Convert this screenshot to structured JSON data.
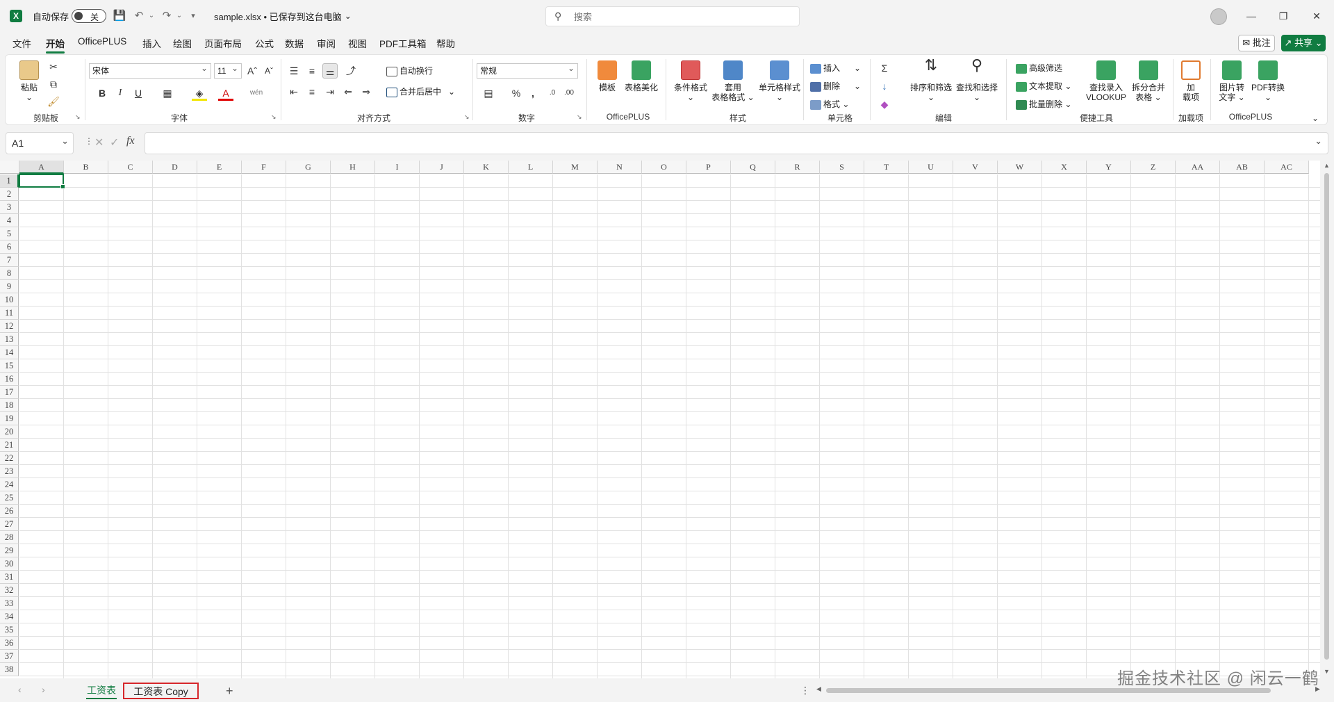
{
  "titlebar": {
    "autosave_label": "自动保存",
    "autosave_state": "关",
    "file_title": "sample.xlsx • 已保存到这台电脑",
    "search_placeholder": "搜索"
  },
  "menu": {
    "tabs": [
      "文件",
      "开始",
      "OfficePLUS",
      "插入",
      "绘图",
      "页面布局",
      "公式",
      "数据",
      "审阅",
      "视图",
      "PDF工具箱",
      "帮助"
    ],
    "active": "开始",
    "comment_label": "批注",
    "share_label": "共享"
  },
  "ribbon": {
    "clipboard": {
      "paste": "粘贴",
      "group": "剪贴板"
    },
    "font": {
      "name": "宋体",
      "size": "11",
      "group": "字体",
      "bold": "B",
      "italic": "I",
      "underline": "U"
    },
    "align": {
      "wrap": "自动换行",
      "merge": "合并后居中",
      "group": "对齐方式"
    },
    "number": {
      "format": "常规",
      "group": "数字"
    },
    "officeplus1": {
      "template": "模板",
      "beautify": "表格美化",
      "group": "OfficePLUS"
    },
    "styles": {
      "conditional": "条件格式",
      "table_format_1": "套用",
      "table_format_2": "表格格式",
      "cell_style": "单元格样式",
      "group": "样式"
    },
    "cells": {
      "insert": "插入",
      "delete": "删除",
      "format": "格式",
      "group": "单元格"
    },
    "editing": {
      "sort": "排序和筛选",
      "find": "查找和选择",
      "group": "编辑"
    },
    "tools": {
      "adv_filter": "高级筛选",
      "text_extract": "文本提取",
      "batch_delete": "批量删除",
      "lookup_1": "查找录入",
      "lookup_2": "VLOOKUP",
      "split_1": "拆分合并",
      "split_2": "表格",
      "group": "便捷工具"
    },
    "addins": {
      "load_1": "加",
      "load_2": "载项",
      "group": "加载项"
    },
    "officeplus2": {
      "img_1": "图片转",
      "img_2": "文字",
      "pdf": "PDF转换",
      "group": "OfficePLUS"
    }
  },
  "formula_bar": {
    "name_box": "A1",
    "fx": "fx",
    "value": ""
  },
  "sheet": {
    "columns": [
      "A",
      "B",
      "C",
      "D",
      "E",
      "F",
      "G",
      "H",
      "I",
      "J",
      "K",
      "L",
      "M",
      "N",
      "O",
      "P",
      "Q",
      "R",
      "S",
      "T",
      "U",
      "V",
      "W",
      "X",
      "Y",
      "Z",
      "AA",
      "AB",
      "AC"
    ],
    "rows": [
      "1",
      "2",
      "3",
      "4",
      "5",
      "6",
      "7",
      "8",
      "9",
      "10",
      "11",
      "12",
      "13",
      "14",
      "15",
      "16",
      "17",
      "18",
      "19",
      "20",
      "21",
      "22",
      "23",
      "24",
      "25",
      "26",
      "27",
      "28",
      "29",
      "30",
      "31",
      "32",
      "33",
      "34",
      "35",
      "36",
      "37",
      "38"
    ],
    "selected_cell": "A1"
  },
  "tabs": {
    "sheets": [
      "工资表",
      "工资表 Copy"
    ],
    "active": "工资表",
    "add": "+"
  },
  "watermark": "掘金技术社区 @ 闲云一鹤",
  "colors": {
    "accent": "#107c41",
    "highlight_border": "#d6262a"
  }
}
